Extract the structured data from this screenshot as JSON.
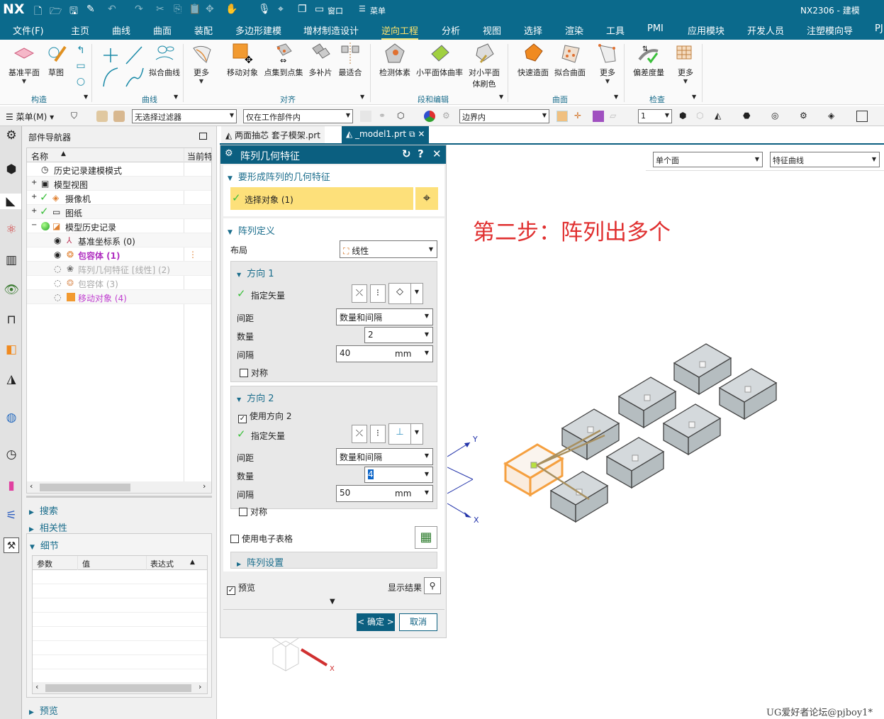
{
  "app": {
    "logo": "NX",
    "title": "NX2306 - 建模",
    "quick_access": {
      "window_label": "窗口",
      "menu_label": "菜单"
    }
  },
  "menu_tabs": [
    "文件(F)",
    "主页",
    "曲线",
    "曲面",
    "装配",
    "多边形建模",
    "增材制造设计",
    "逆向工程",
    "分析",
    "视图",
    "选择",
    "渲染",
    "工具",
    "PMI",
    "应用模块",
    "开发人员",
    "注塑模向导",
    "PJ"
  ],
  "active_tab": "逆向工程",
  "ribbon": {
    "groups": [
      {
        "label": "构造",
        "items": [
          "基准平面",
          "草图"
        ]
      },
      {
        "label": "曲线",
        "items": [
          "拟合曲线",
          "更多"
        ]
      },
      {
        "label": "对齐",
        "items": [
          "移动对象",
          "点集到点集",
          "多补片",
          "最适合"
        ]
      },
      {
        "label": "段和编辑",
        "items": [
          "检测体素",
          "小平面体曲率",
          "对小平面体刷色"
        ]
      },
      {
        "label": "曲面",
        "items": [
          "快速造面",
          "拟合曲面",
          "更多"
        ]
      },
      {
        "label": "检查",
        "items": [
          "偏差度量",
          "更多"
        ]
      }
    ]
  },
  "toolbar": {
    "menu_label": "菜单(M)",
    "filter": "无选择过滤器",
    "scope": "仅在工作部件内",
    "boundary": "边界内",
    "layer": "1"
  },
  "navigator": {
    "title": "部件导航器",
    "columns": [
      "名称",
      "当前特"
    ],
    "rows": [
      {
        "label": "历史记录建模模式",
        "state": "normal"
      },
      {
        "label": "模型视图",
        "state": "normal"
      },
      {
        "label": "摄像机",
        "state": "normal"
      },
      {
        "label": "图纸",
        "state": "normal"
      },
      {
        "label": "模型历史记录",
        "state": "normal"
      },
      {
        "label": "基准坐标系 (0)",
        "state": "normal"
      },
      {
        "label": "包容体 (1)",
        "state": "highlight"
      },
      {
        "label": "阵列几何特征 [线性] (2)",
        "state": "suppressed"
      },
      {
        "label": "包容体 (3)",
        "state": "suppressed"
      },
      {
        "label": "移动对象 (4)",
        "state": "highlight-light"
      }
    ],
    "sections": [
      "搜索",
      "相关性",
      "细节",
      "预览"
    ],
    "details_columns": [
      "参数",
      "值",
      "表达式"
    ]
  },
  "tabs": [
    {
      "label": "两面抽芯 套子模架.prt"
    },
    {
      "label": "_model1.prt"
    }
  ],
  "dialog": {
    "title": "阵列几何特征",
    "section_geometry": "要形成阵列的几何特征",
    "select_object": "选择对象 (1)",
    "section_definition": "阵列定义",
    "layout_label": "布局",
    "layout_value": "线性",
    "dir1": {
      "title": "方向 1",
      "vector_label": "指定矢量",
      "spacing_label": "间距",
      "spacing_value": "数量和间隔",
      "count_label": "数量",
      "count_value": "2",
      "pitch_label": "间隔",
      "pitch_value": "40",
      "unit": "mm",
      "symmetric_label": "对称"
    },
    "dir2": {
      "title": "方向 2",
      "use_label": "使用方向 2",
      "vector_label": "指定矢量",
      "spacing_label": "间距",
      "spacing_value": "数量和间隔",
      "count_label": "数量",
      "count_value": "4",
      "pitch_label": "间隔",
      "pitch_value": "50",
      "unit": "mm",
      "symmetric_label": "对称"
    },
    "spreadsheet_label": "使用电子表格",
    "settings_label": "阵列设置",
    "preview_label": "预览",
    "show_result_label": "显示结果",
    "ok_label": "< 确定 >",
    "cancel_label": "取消"
  },
  "viewport": {
    "face_rule": "单个面",
    "curve_rule": "特征曲线",
    "annotation": "第二步：阵列出多个",
    "axis_labels": {
      "x": "X",
      "y": "Y"
    },
    "watermark": "UG爱好者论坛@pjboy1*",
    "colors": {
      "annotation": "#e03030",
      "selected": "#f5a040",
      "axis": "#2233aa"
    }
  }
}
